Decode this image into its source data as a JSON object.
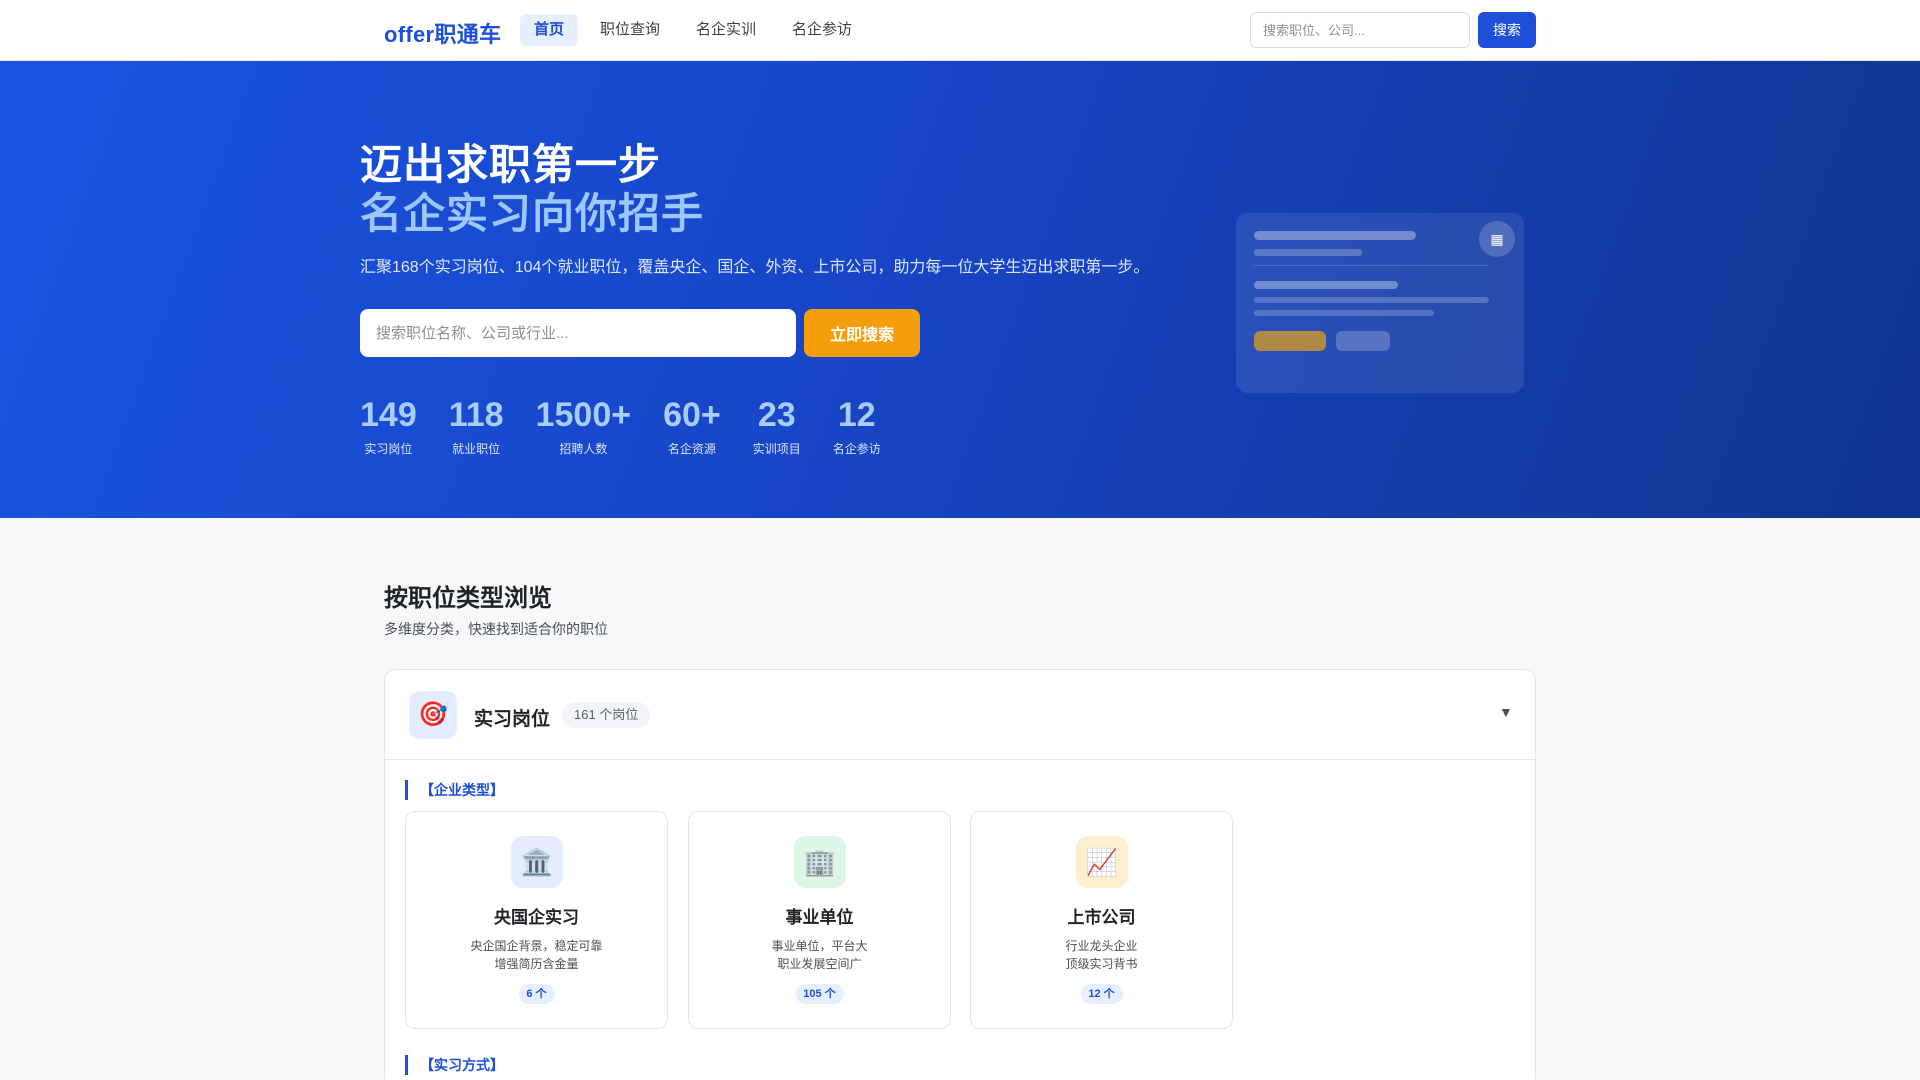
{
  "nav": {
    "brand": "offer职通车",
    "links": [
      "首页",
      "职位查询",
      "名企实训",
      "名企参访"
    ],
    "search_placeholder": "搜索职位、公司...",
    "search_button": "搜索"
  },
  "hero": {
    "title_line1": "迈出求职第一步",
    "title_line2": "名企实习向你招手",
    "description": "汇聚168个实习岗位、104个就业职位，覆盖央企、国企、外资、上市公司，助力每一位大学生迈出求职第一步。",
    "search_placeholder": "搜索职位名称、公司或行业...",
    "search_button": "立即搜索",
    "stats": [
      {
        "value": "149",
        "label": "实习岗位"
      },
      {
        "value": "118",
        "label": "就业职位"
      },
      {
        "value": "1500+",
        "label": "招聘人数"
      },
      {
        "value": "60+",
        "label": "名企资源"
      },
      {
        "value": "23",
        "label": "实训项目"
      },
      {
        "value": "12",
        "label": "名企参访"
      }
    ],
    "mock_icon": "building-icon"
  },
  "section": {
    "title": "按职位类型浏览",
    "subtitle": "多维度分类，快速找到适合你的职位"
  },
  "panel": {
    "icon": "target-icon",
    "title": "实习岗位",
    "count": "161 个岗位",
    "chevron": "▼",
    "group1_label": "【企业类型】",
    "group2_label": "【实习方式】",
    "cards": [
      {
        "icon": "bank-icon",
        "glyph": "🏛️",
        "icon_bg": "#e4edff",
        "title": "央国企实习",
        "desc1": "央企国企背景，稳定可靠",
        "desc2": "增强简历含金量",
        "badge": "6 个"
      },
      {
        "icon": "office-building-icon",
        "glyph": "🏢",
        "icon_bg": "#dcf7e6",
        "title": "事业单位",
        "desc1": "事业单位，平台大",
        "desc2": "职业发展空间广",
        "badge": "105 个"
      },
      {
        "icon": "chart-up-icon",
        "glyph": "📈",
        "icon_bg": "#fdf0cf",
        "title": "上市公司",
        "desc1": "行业龙头企业",
        "desc2": "顶级实习背书",
        "badge": "12 个"
      }
    ]
  },
  "colors": {
    "brand": "#1d4fd8",
    "accent_orange": "#f59e0b",
    "hero_start": "#1a55e0",
    "hero_end": "#10358f"
  }
}
